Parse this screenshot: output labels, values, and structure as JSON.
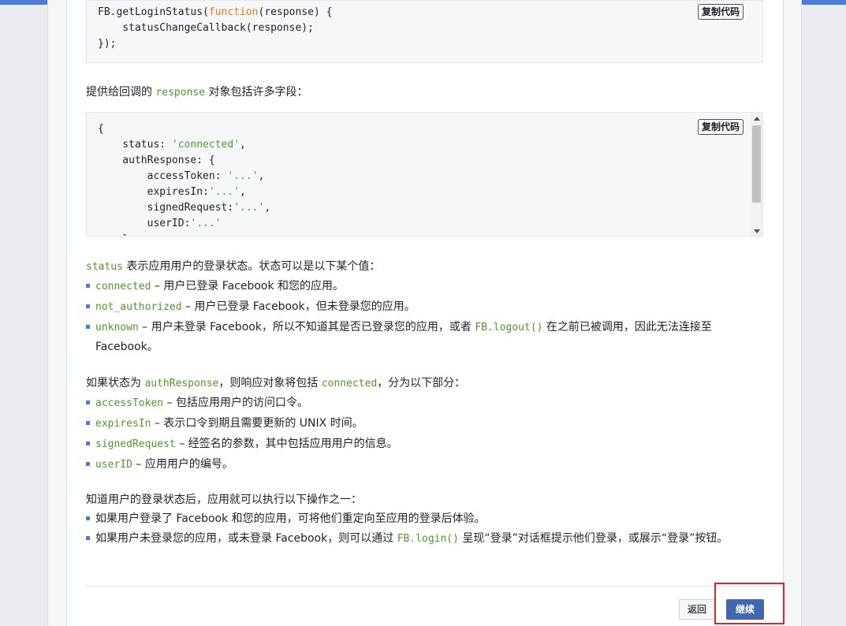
{
  "code_block_1": {
    "copy_label": "复制代码",
    "line1_a": "FB.getLoginStatus(",
    "line1_kw": "function",
    "line1_b": "(response) {",
    "line2": "    statusChangeCallback(response);",
    "line3": "});"
  },
  "para_response": {
    "before": "提供给回调的 ",
    "code": "response",
    "after": " 对象包括许多字段："
  },
  "code_block_2": {
    "copy_label": "复制代码",
    "l1": "{",
    "l2_key": "    status: ",
    "l2_val": "'connected'",
    "l2_end": ",",
    "l3": "    authResponse: {",
    "l4_key": "        accessToken: ",
    "l4_val": "'...'",
    "l4_end": ",",
    "l5_key": "        expiresIn:",
    "l5_val": "'...'",
    "l5_end": ",",
    "l6_key": "        signedRequest:",
    "l6_val": "'...'",
    "l6_end": ",",
    "l7_key": "        userID:",
    "l7_val": "'...'",
    "l8": "    }"
  },
  "status_intro": {
    "code": "status",
    "text": " 表示应用用户的登录状态。状态可以是以下某个值："
  },
  "status_list": [
    {
      "code": "connected",
      "text": " – 用户已登录 Facebook 和您的应用。"
    },
    {
      "code": "not_authorized",
      "text": " – 用户已登录 Facebook，但未登录您的应用。"
    },
    {
      "code": "unknown",
      "text": " – 用户未登录 Facebook，所以不知道其是否已登录您的应用，或者 ",
      "code2": "FB.logout()",
      "text2": " 在之前已被调用，因此无法连接至 Facebook。"
    }
  ],
  "auth_intro": {
    "before": "如果状态为 ",
    "code1": "authResponse",
    "middle": "，则响应对象将包括 ",
    "code2": "connected",
    "after": "，分为以下部分："
  },
  "auth_list": [
    {
      "code": "accessToken",
      "text": " – 包括应用用户的访问口令。"
    },
    {
      "code": "expiresIn",
      "text": " – 表示口令到期且需要更新的 UNIX 时间。"
    },
    {
      "code": "signedRequest",
      "text": " – 经签名的参数，其中包括应用用户的信息。"
    },
    {
      "code": "userID",
      "text": " – 应用用户的编号。"
    }
  ],
  "actions_intro": "知道用户的登录状态后，应用就可以执行以下操作之一：",
  "actions_list": [
    {
      "text": "如果用户登录了 Facebook 和您的应用，可将他们重定向至应用的登录后体验。"
    },
    {
      "text": "如果用户未登录您的应用，或未登录 Facebook，则可以通过 ",
      "code": "FB.login()",
      "text2": " 呈现“登录”对话框提示他们登录，或展示“登录”按钮。"
    }
  ],
  "footer": {
    "back_label": "返回",
    "continue_label": "继续"
  },
  "colors": {
    "primary_button": "#4267b2",
    "code_green": "#4c9a2a",
    "keyword_orange": "#e07b16",
    "highlight_red": "#e02424",
    "bullet_blue": "#4a7bd6"
  }
}
